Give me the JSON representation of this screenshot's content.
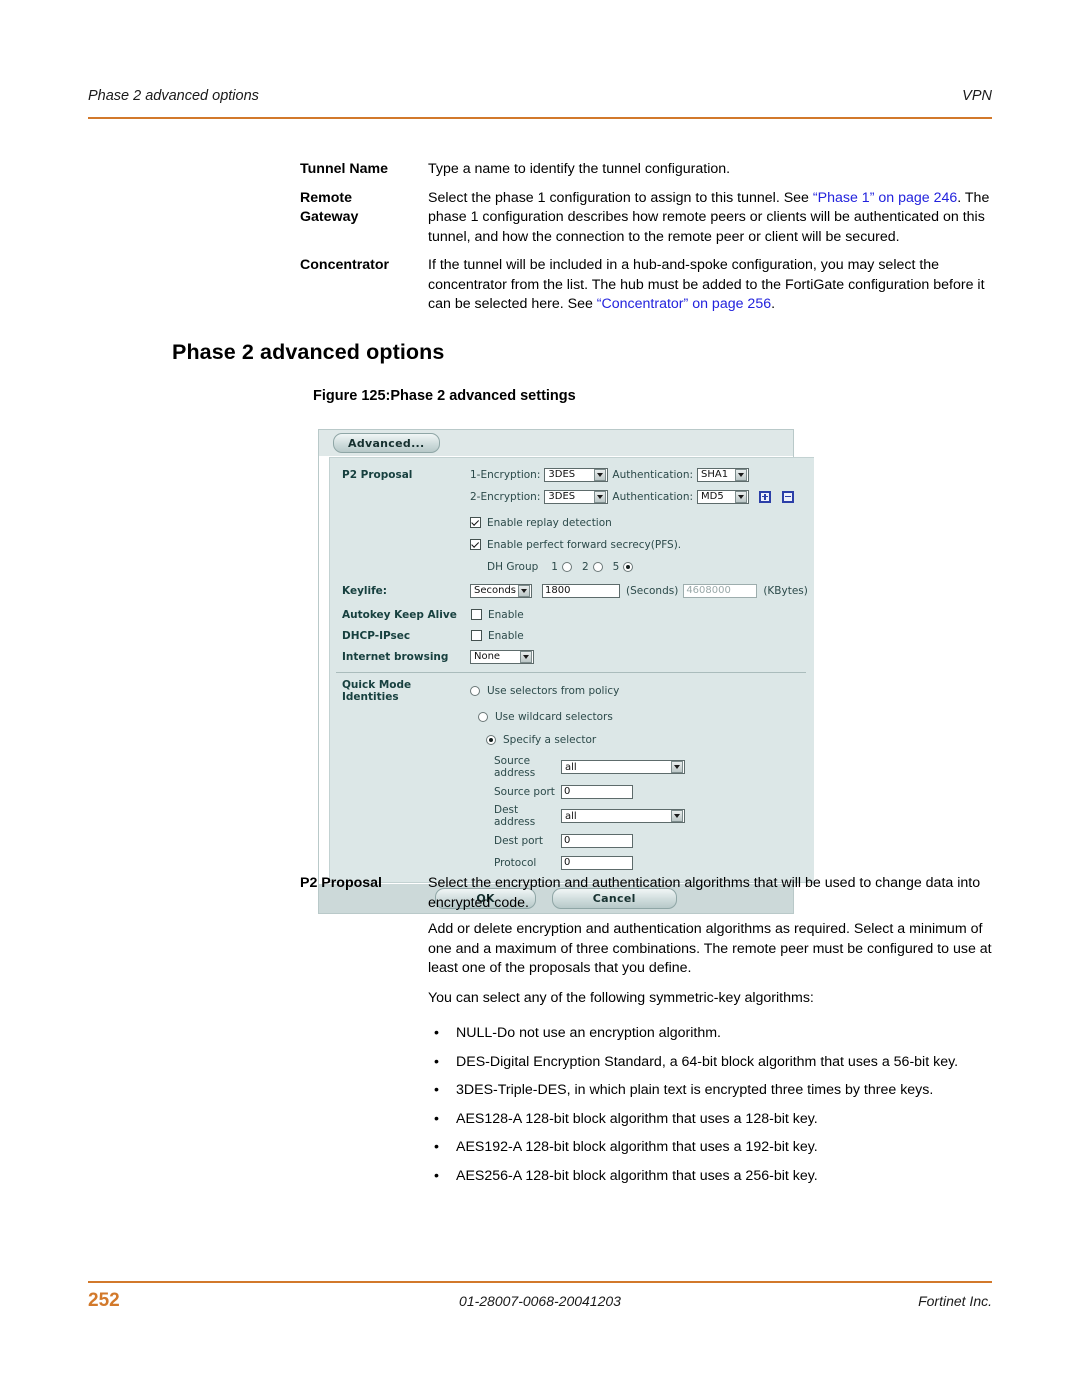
{
  "header": {
    "left": "Phase 2 advanced options",
    "right": "VPN"
  },
  "definitions": [
    {
      "term": [
        "Tunnel Name"
      ],
      "segments": [
        {
          "text": "Type a name to identify the tunnel configuration.",
          "link": false
        }
      ]
    },
    {
      "term": [
        "Remote",
        "Gateway"
      ],
      "segments": [
        {
          "text": "Select the phase 1 configuration to assign to this tunnel. See ",
          "link": false
        },
        {
          "text": "“Phase 1” on page 246",
          "link": true
        },
        {
          "text": ". The phase 1 configuration describes how remote peers or clients will be authenticated on this tunnel, and how the connection to the remote peer or client will be secured.",
          "link": false
        }
      ]
    },
    {
      "term": [
        "Concentrator"
      ],
      "segments": [
        {
          "text": "If the tunnel will be included in a hub-and-spoke configuration, you may select the concentrator from the list. The hub must be added to the FortiGate configuration before it can be selected here. See ",
          "link": false
        },
        {
          "text": "“Concentrator” on page 256",
          "link": true
        },
        {
          "text": ".",
          "link": false
        }
      ]
    }
  ],
  "section_heading": "Phase 2 advanced options",
  "figure_caption": "Figure 125:Phase 2 advanced settings",
  "gui": {
    "advanced_button": "Advanced...",
    "p2_proposal_label": "P2 Proposal",
    "proposals": [
      {
        "enc_label": "1-Encryption:",
        "enc_value": "3DES",
        "auth_label": "Authentication:",
        "auth_value": "SHA1",
        "has_addremove": false
      },
      {
        "enc_label": "2-Encryption:",
        "enc_value": "3DES",
        "auth_label": "Authentication:",
        "auth_value": "MD5",
        "has_addremove": true
      }
    ],
    "replay_detection": {
      "label": "Enable replay detection",
      "checked": true
    },
    "pfs": {
      "label": "Enable perfect forward secrecy(PFS).",
      "checked": true
    },
    "dh_group": {
      "label": "DH Group",
      "options": [
        {
          "label": "1",
          "selected": false
        },
        {
          "label": "2",
          "selected": false
        },
        {
          "label": "5",
          "selected": true
        }
      ]
    },
    "keylife": {
      "label": "Keylife:",
      "unit_select": "Seconds",
      "seconds_value": "1800",
      "seconds_suffix": "(Seconds)",
      "kbytes_value": "4608000",
      "kbytes_suffix": "(KBytes)",
      "kbytes_disabled": true
    },
    "autokey_keep_alive": {
      "label": "Autokey Keep Alive",
      "checkbox_label": "Enable",
      "checked": false
    },
    "dhcp_ipsec": {
      "label": "DHCP-IPsec",
      "checkbox_label": "Enable",
      "checked": false
    },
    "internet_browsing": {
      "label": "Internet browsing",
      "value": "None"
    },
    "quick_mode_identities": {
      "label": "Quick Mode Identities",
      "options": [
        {
          "label": "Use selectors from policy",
          "selected": false
        },
        {
          "label": "Use wildcard selectors",
          "selected": false
        },
        {
          "label": "Specify a selector",
          "selected": true
        }
      ]
    },
    "selector_fields": [
      {
        "label": "Source address",
        "value": "all",
        "type": "select"
      },
      {
        "label": "Source port",
        "value": "0",
        "type": "text"
      },
      {
        "label": "Dest address",
        "value": "all",
        "type": "select"
      },
      {
        "label": "Dest port",
        "value": "0",
        "type": "text"
      },
      {
        "label": "Protocol",
        "value": "0",
        "type": "text"
      }
    ],
    "ok_button": "OK",
    "cancel_button": "Cancel"
  },
  "p2_proposal_doc": {
    "term": "P2 Proposal",
    "paragraphs": [
      "Select the encryption and authentication algorithms that will be used to change data into encrypted code.",
      "Add or delete encryption and authentication algorithms as required. Select a minimum of one and a maximum of three combinations. The remote peer must be configured to use at least one of the proposals that you define.",
      "You can select any of the following symmetric-key algorithms:"
    ],
    "bullets": [
      "NULL-Do not use an encryption algorithm.",
      "DES-Digital Encryption Standard, a 64-bit block algorithm that uses a 56-bit key.",
      "3DES-Triple-DES, in which plain text is encrypted three times by three keys.",
      "AES128-A 128-bit block algorithm that uses a 128-bit key.",
      "AES192-A 128-bit block algorithm that uses a 192-bit key.",
      "AES256-A 128-bit block algorithm that uses a 256-bit key."
    ],
    "bullet_marker": "•"
  },
  "footer": {
    "page_number": "252",
    "document_id": "01-28007-0068-20041203",
    "organization": "Fortinet Inc."
  },
  "colors": {
    "rule": "#d2792b",
    "link": "#2222dd",
    "page_number": "#d2792b",
    "gui_background": "#dce7e7",
    "gui_footer": "#ccd9d9"
  }
}
